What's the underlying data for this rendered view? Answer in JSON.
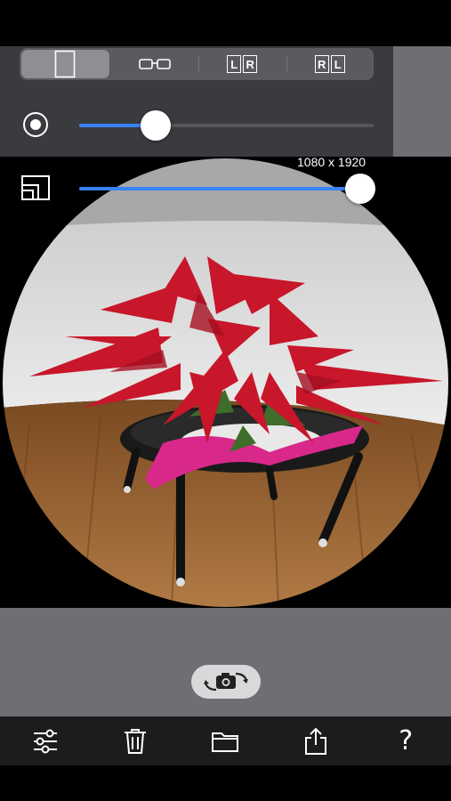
{
  "top_controls": {
    "modes": [
      {
        "name": "single",
        "selected": true
      },
      {
        "name": "glasses"
      },
      {
        "name": "lr",
        "letters": [
          "L",
          "R"
        ]
      },
      {
        "name": "rl",
        "letters": [
          "R",
          "L"
        ]
      }
    ],
    "fisheye_slider": {
      "value": 0.26
    },
    "size_slider": {
      "value": 1.0
    },
    "resolution_label": "1080 x 1920"
  },
  "colors": {
    "panel": "#3a3b3f",
    "accent": "#3a82f7",
    "bottom_panel": "#6e6e73",
    "tabbar": "#1c1c1e"
  },
  "icons": {
    "mode_single": "portrait-rectangle-icon",
    "mode_glasses": "glasses-icon",
    "fisheye": "target-circle-icon",
    "size": "resize-frame-icon",
    "camera_switch": "camera-rotate-icon",
    "settings": "sliders-icon",
    "delete": "trash-icon",
    "folder": "folder-icon",
    "share": "share-icon",
    "help": "question-mark-icon"
  },
  "tabbar": {
    "help_label": "?"
  }
}
